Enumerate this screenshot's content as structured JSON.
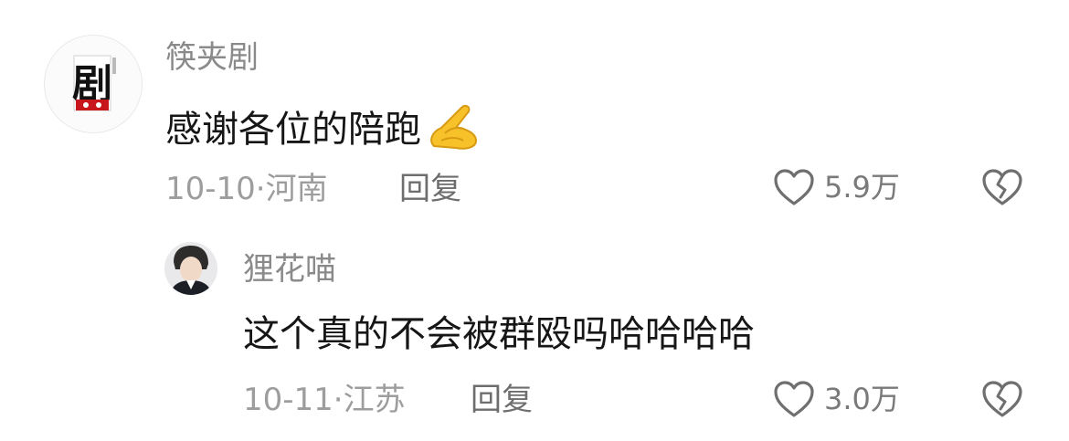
{
  "comments": [
    {
      "username": "筷夹剧",
      "avatar_icon": "drama-logo-avatar",
      "avatar_text": "剧",
      "text": "感谢各位的陪跑",
      "emoji": "pray-hands-emoji",
      "date": "10-10",
      "location": "河南",
      "reply_label": "回复",
      "likes": "5.9万"
    },
    {
      "username": "狸花喵",
      "avatar_icon": "user-photo-avatar",
      "text": "这个真的不会被群殴吗哈哈哈哈",
      "date": "10-11",
      "location": "江苏",
      "reply_label": "回复",
      "likes": "3.0万"
    }
  ],
  "colors": {
    "username": "#8a8a8a",
    "text": "#161616",
    "meta": "#9d9d9d",
    "icon_stroke": "#6f6f6f",
    "emoji_yellow": "#f7c12a"
  }
}
